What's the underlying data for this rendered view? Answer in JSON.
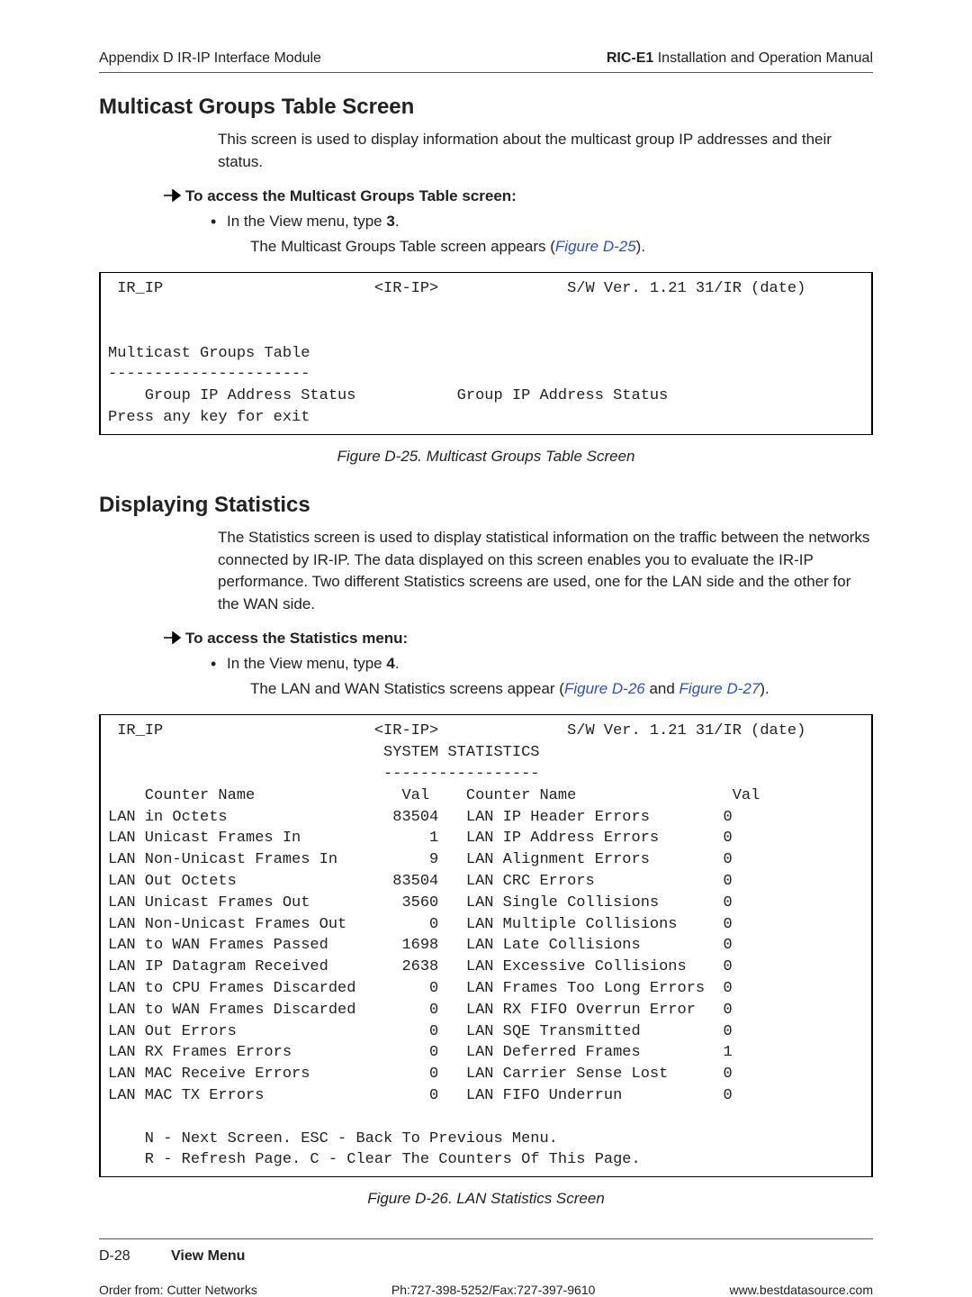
{
  "header": {
    "left": "Appendix D  IR-IP Interface Module",
    "right_bold": "RIC-E1",
    "right_rest": " Installation and Operation Manual"
  },
  "section1": {
    "title": "Multicast Groups Table Screen",
    "para": "This screen is used to display information about the multicast group IP addresses and their status.",
    "proc": "To access the Multicast Groups Table screen:",
    "bullet_pre": "In the View menu, type ",
    "bullet_bold": "3",
    "bullet_post": ".",
    "result_pre": "The Multicast Groups Table screen appears (",
    "result_ref": "Figure D-25",
    "result_post": ")."
  },
  "terminal1": " IR_IP                       <IR-IP>              S/W Ver. 1.21 31/IR (date)\n\n\nMulticast Groups Table\n----------------------\n    Group IP Address Status           Group IP Address Status\nPress any key for exit",
  "caption1": "Figure D-25.  Multicast Groups Table Screen",
  "section2": {
    "title": "Displaying Statistics",
    "para": "The Statistics screen is used to display statistical information on the traffic between the networks connected by IR-IP. The data displayed on this screen enables you to evaluate the IR-IP performance. Two different Statistics screens are used, one for the LAN side and the other for the WAN side.",
    "proc": "To access the Statistics menu:",
    "bullet_pre": "In the View menu, type ",
    "bullet_bold": "4",
    "bullet_post": ".",
    "result_pre": "The LAN and WAN Statistics screens appear (",
    "result_ref1": "Figure D-26",
    "result_mid": " and ",
    "result_ref2": "Figure D-27",
    "result_post": ")."
  },
  "terminal2_header": " IR_IP                       <IR-IP>              S/W Ver. 1.21 31/IR (date)",
  "terminal2_title": "SYSTEM STATISTICS",
  "terminal2_dashes": "-----------------",
  "terminal2_colhdr": "    Counter Name                Val    Counter Name                 Val",
  "stats": [
    {
      "l": "LAN in Octets",
      "lv": "83504",
      "r": "LAN IP Header Errors",
      "rv": "0"
    },
    {
      "l": "LAN Unicast Frames In",
      "lv": "1",
      "r": "LAN IP Address Errors",
      "rv": "0"
    },
    {
      "l": "LAN Non-Unicast Frames In",
      "lv": "9",
      "r": "LAN Alignment Errors",
      "rv": "0"
    },
    {
      "l": "LAN Out Octets",
      "lv": "83504",
      "r": "LAN CRC Errors",
      "rv": "0"
    },
    {
      "l": "LAN Unicast Frames Out",
      "lv": "3560",
      "r": "LAN Single Collisions",
      "rv": "0"
    },
    {
      "l": "LAN Non-Unicast Frames Out",
      "lv": "0",
      "r": "LAN Multiple Collisions",
      "rv": "0"
    },
    {
      "l": "LAN to WAN Frames Passed",
      "lv": "1698",
      "r": "LAN Late Collisions",
      "rv": "0"
    },
    {
      "l": "LAN IP Datagram Received",
      "lv": "2638",
      "r": "LAN Excessive Collisions",
      "rv": "0"
    },
    {
      "l": "LAN to CPU Frames Discarded",
      "lv": "0",
      "r": "LAN Frames Too Long Errors",
      "rv": "0"
    },
    {
      "l": "LAN to WAN Frames Discarded",
      "lv": "0",
      "r": "LAN RX FIFO Overrun Error",
      "rv": "0"
    },
    {
      "l": "LAN Out Errors",
      "lv": "0",
      "r": "LAN SQE Transmitted",
      "rv": "0"
    },
    {
      "l": "LAN RX Frames Errors",
      "lv": "0",
      "r": "LAN Deferred Frames",
      "rv": "1"
    },
    {
      "l": "LAN MAC Receive Errors",
      "lv": "0",
      "r": "LAN Carrier Sense Lost",
      "rv": "0"
    },
    {
      "l": "LAN MAC TX Errors",
      "lv": "0",
      "r": "LAN FIFO Underrun",
      "rv": "0"
    }
  ],
  "terminal2_footer1": "    N - Next Screen. ESC - Back To Previous Menu.",
  "terminal2_footer2": "    R - Refresh Page. C - Clear The Counters Of This Page.",
  "caption2": "Figure D-26.  LAN Statistics Screen",
  "footer": {
    "pagenum": "D-28",
    "title": "View Menu",
    "order": "Order from: Cutter Networks",
    "phone": "Ph:727-398-5252/Fax:727-397-9610",
    "url": "www.bestdatasource.com"
  }
}
